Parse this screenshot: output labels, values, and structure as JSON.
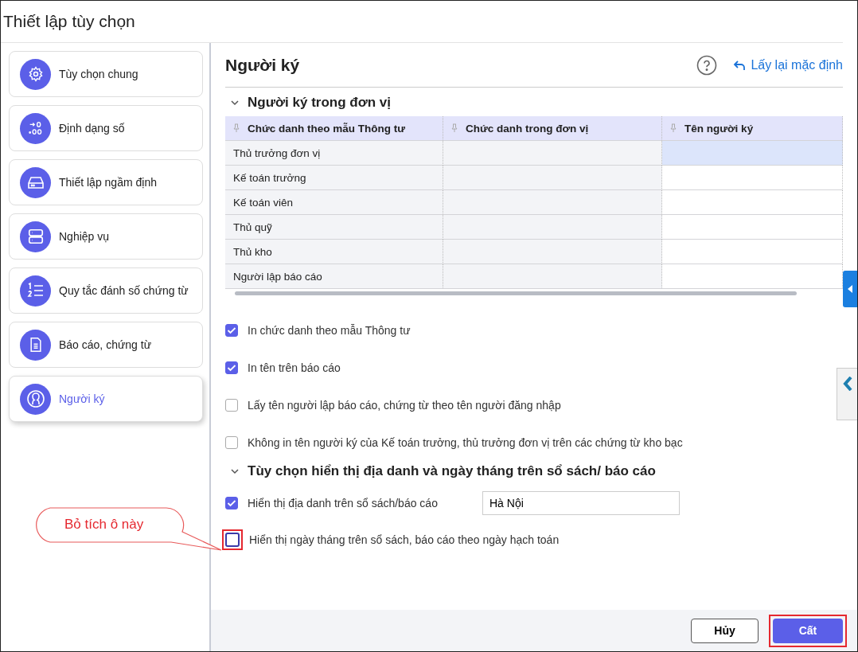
{
  "window": {
    "title": "Thiết lập tùy chọn"
  },
  "sidebar": {
    "items": [
      {
        "label": "Tùy chọn chung",
        "selected": false
      },
      {
        "label": "Định dạng số",
        "selected": false
      },
      {
        "label": "Thiết lập ngầm định",
        "selected": false
      },
      {
        "label": "Nghiệp vụ",
        "selected": false
      },
      {
        "label": "Quy tắc đánh số chứng từ",
        "selected": false
      },
      {
        "label": "Báo cáo, chứng từ",
        "selected": false
      },
      {
        "label": "Người ký",
        "selected": true
      }
    ]
  },
  "page": {
    "title": "Người ký",
    "reset_link": "Lấy lại mặc định"
  },
  "section1": {
    "title": "Người ký trong đơn vị",
    "expanded": true,
    "table": {
      "columns": [
        "Chức danh theo mẫu Thông tư",
        "Chức danh trong đơn vị",
        "Tên người ký"
      ],
      "rows": [
        {
          "cells": [
            "Thủ trưởng đơn vị",
            "",
            ""
          ],
          "selected": true
        },
        {
          "cells": [
            "Kế toán trưởng",
            "",
            ""
          ],
          "selected": false
        },
        {
          "cells": [
            "Kế toán viên",
            "",
            ""
          ],
          "selected": false
        },
        {
          "cells": [
            "Thủ quỹ",
            "",
            ""
          ],
          "selected": false
        },
        {
          "cells": [
            "Thủ kho",
            "",
            ""
          ],
          "selected": false
        },
        {
          "cells": [
            "Người lập báo cáo",
            "",
            ""
          ],
          "selected": false
        }
      ]
    },
    "options": [
      {
        "label": "In chức danh theo mẫu Thông tư",
        "checked": true
      },
      {
        "label": "In tên trên báo cáo",
        "checked": true
      },
      {
        "label": "Lấy tên người lập báo cáo, chứng từ theo tên người đăng nhập",
        "checked": false
      },
      {
        "label": "Không in tên người ký của Kế toán trưởng, thủ trưởng đơn vị trên các chứng từ kho bạc",
        "checked": false
      }
    ]
  },
  "section2": {
    "title": "Tùy chọn hiển thị địa danh và ngày tháng trên sổ sách/ báo cáo",
    "expanded": true,
    "options": [
      {
        "kind": "input",
        "label": "Hiển thị địa danh trên sổ sách/báo cáo",
        "checked": true,
        "value": "Hà Nội",
        "highlighted": false
      },
      {
        "kind": "plain",
        "label": "Hiển thị ngày tháng trên sổ sách, báo cáo theo ngày hạch toán",
        "checked": false,
        "highlighted": true
      }
    ]
  },
  "annotation": {
    "text": "Bỏ tích ô này"
  },
  "buttons": [
    {
      "label": "Hủy",
      "kind": "secondary",
      "highlighted": false
    },
    {
      "label": "Cất",
      "kind": "primary",
      "highlighted": true
    }
  ]
}
